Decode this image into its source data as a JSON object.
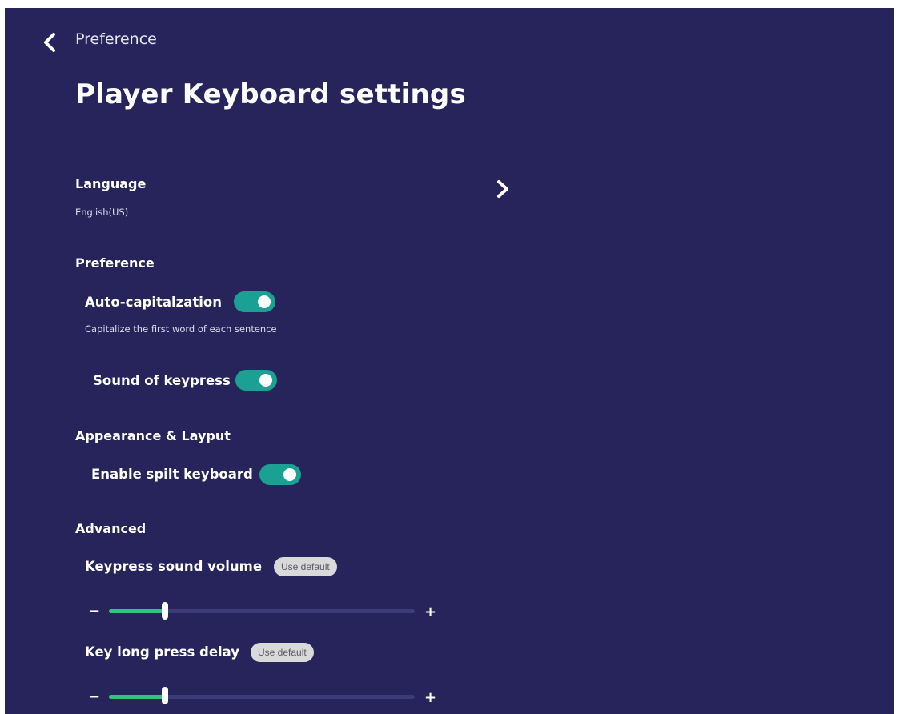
{
  "header": {
    "breadcrumb": "Preference",
    "title": "Player Keyboard settings"
  },
  "language": {
    "label": "Language",
    "value": "English(US)"
  },
  "preference": {
    "heading": "Preference",
    "auto_cap": {
      "label": "Auto-capitalzation",
      "description": "Capitalize the first word of each sentence",
      "on": true
    },
    "keypress_sound": {
      "label": "Sound of keypress",
      "on": true
    }
  },
  "appearance": {
    "heading": "Appearance & Layput",
    "split_keyboard": {
      "label": "Enable spilt keyboard",
      "on": true
    }
  },
  "advanced": {
    "heading": "Advanced",
    "volume": {
      "label": "Keypress sound volume",
      "default_label": "Use default",
      "minus": "−",
      "plus": "+",
      "level": 0.18
    },
    "long_press": {
      "label": "Key long press delay",
      "default_label": "Use default",
      "minus": "−",
      "plus": "+",
      "level": 0.18
    }
  },
  "icons": {
    "back": "chevron-left-icon",
    "forward": "chevron-right-icon"
  },
  "colors": {
    "background": "#26245a",
    "toggle_on": "#1aa193",
    "slider_fill": "#35c27e",
    "slider_track": "#3c3c78"
  }
}
